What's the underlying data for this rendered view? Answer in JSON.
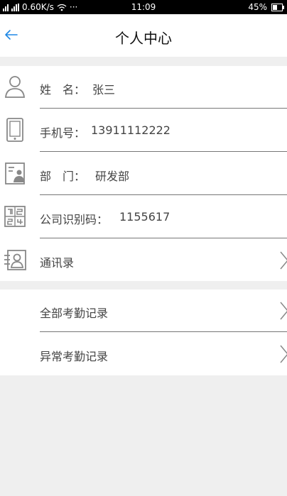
{
  "status_bar": {
    "network_speed": "0.60K/s",
    "extra": "···",
    "time": "11:09",
    "battery_percent": "45%"
  },
  "header": {
    "title": "个人中心",
    "back_icon": "arrow-left-icon"
  },
  "profile": {
    "name": {
      "label": "姓　名：",
      "value": "张三",
      "icon": "person-icon"
    },
    "phone": {
      "label": "手机号：",
      "value": "13911112222",
      "icon": "mobile-phone-icon"
    },
    "department": {
      "label": "部　门：",
      "value": "研发部",
      "icon": "id-card-icon"
    },
    "company_code": {
      "label": "公司识别码：",
      "value": "1155617",
      "icon": "code-grid-icon"
    },
    "contacts": {
      "label": "通讯录",
      "icon": "contacts-icon"
    }
  },
  "records": {
    "all_attendance": "全部考勤记录",
    "abnormal_attendance": "异常考勤记录"
  },
  "colors": {
    "accent": "#1e88e5",
    "background": "#efefef",
    "card": "#ffffff",
    "text": "#444444",
    "divider": "#777777"
  }
}
